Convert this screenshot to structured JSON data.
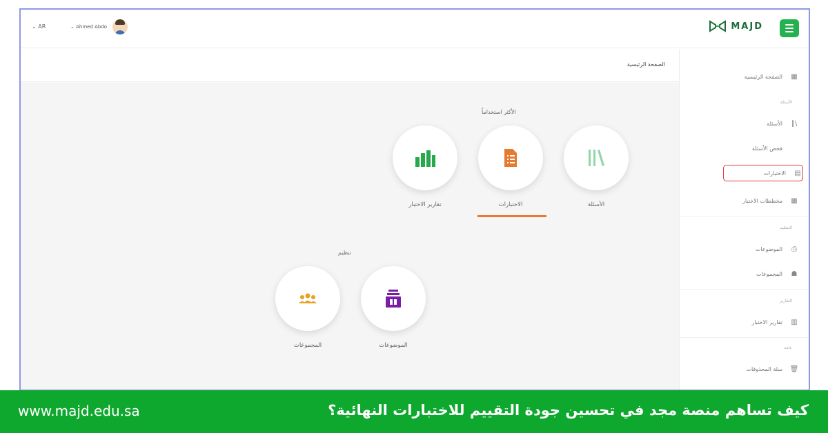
{
  "topbar": {
    "lang": "AR",
    "user_name": "Ahmed Abdo",
    "logo_text": "MAJD"
  },
  "breadcrumb": {
    "current": "الصفحة الرئيسية"
  },
  "sidebar": {
    "items": [
      {
        "label": "الصفحة الرئيسية",
        "icon": "dashboard-icon"
      },
      {
        "section": "الأسئلة"
      },
      {
        "label": "الأسئلة",
        "icon": "books-icon"
      },
      {
        "label": "فحص الأسئلة",
        "icon": ""
      },
      {
        "label": "الاختبارات",
        "icon": "document-icon",
        "active": true
      },
      {
        "label": "مخططات الاختبار",
        "icon": "table-icon"
      },
      {
        "section": "التنظيم"
      },
      {
        "label": "الموضوعات",
        "icon": "topics-icon"
      },
      {
        "label": "المجموعات",
        "icon": "group-icon"
      },
      {
        "section": "التقارير"
      },
      {
        "label": "تقارير الاختبار",
        "icon": "bar-chart-icon"
      },
      {
        "section": "عامة"
      },
      {
        "label": "سلة المحذوفات",
        "icon": "trash-icon"
      }
    ],
    "highlight_color": "#e0383e"
  },
  "main": {
    "most_used_title": "الأكثر استخداماً",
    "organize_title": "تنظيم",
    "tiles_top": [
      {
        "label": "تقارير الاختبار",
        "icon": "bar-chart-icon",
        "color": "#27a84a"
      },
      {
        "label": "الاختبارات",
        "icon": "document-icon",
        "color": "#e47b2f",
        "selected": true
      },
      {
        "label": "الأسئلة",
        "icon": "books-icon",
        "color": "#8fd6a6"
      }
    ],
    "tiles_bottom": [
      {
        "label": "المجموعات",
        "icon": "group-icon",
        "color": "#e9a024"
      },
      {
        "label": "الموضوعات",
        "icon": "topics-icon",
        "color": "#7a1fa2"
      }
    ]
  },
  "banner": {
    "url": "www.majd.edu.sa",
    "title": "كيف تساهم منصة مجد في تحسين جودة التقييم للاختبارات النهائية؟",
    "color": "#0fa82f"
  }
}
